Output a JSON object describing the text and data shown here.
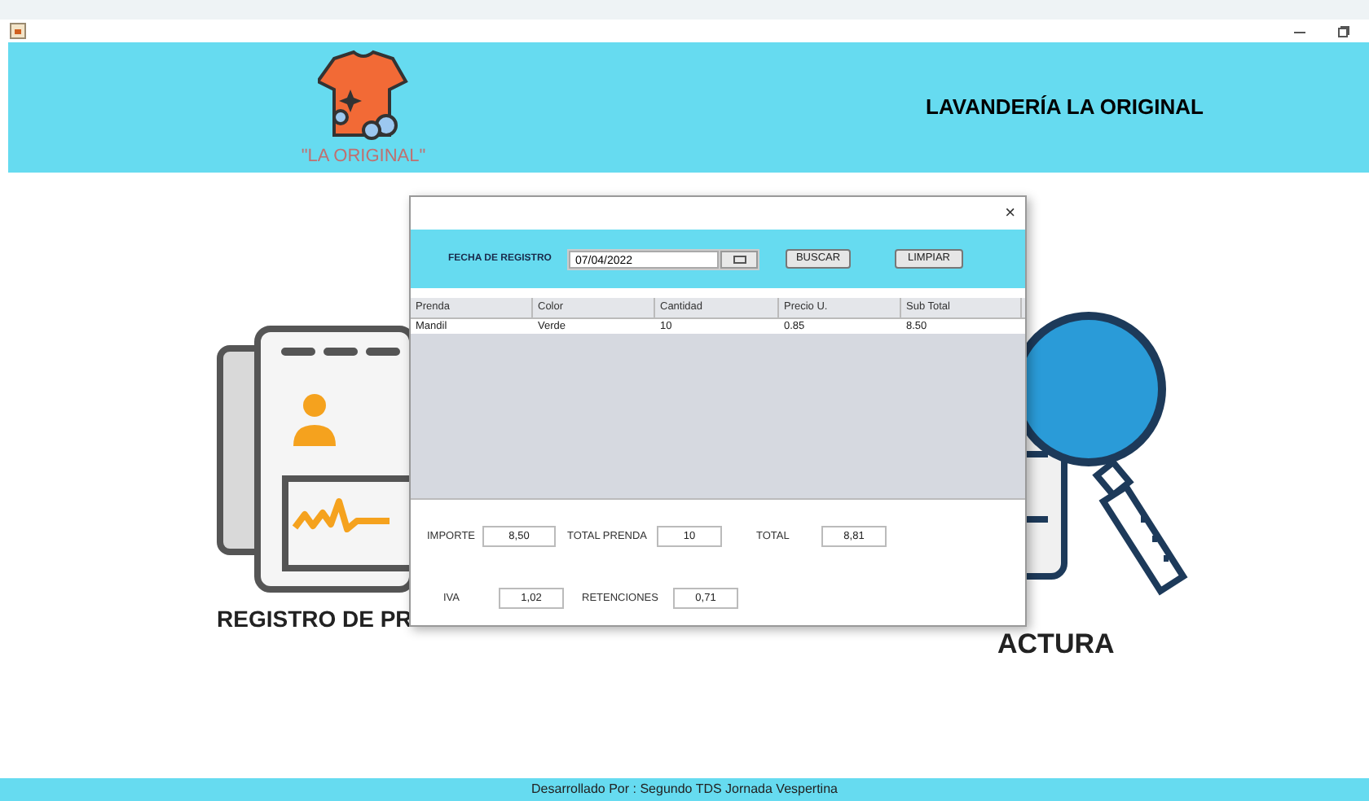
{
  "header": {
    "logo_caption": "\"LA ORIGINAL\"",
    "title": "LAVANDERÍA LA ORIGINAL"
  },
  "main": {
    "left_label": "REGISTRO DE PR",
    "right_label": "ACTURA"
  },
  "dialog": {
    "close": "×",
    "date_label": "FECHA DE REGISTRO",
    "date_value": "07/04/2022",
    "buttons": [
      "BUSCAR",
      "LIMPIAR"
    ],
    "table": {
      "columns": [
        "Prenda",
        "Color",
        "Cantidad",
        "Precio U.",
        "Sub Total"
      ],
      "rows": [
        [
          "Mandil",
          "Verde",
          "10",
          "0.85",
          "8.50"
        ]
      ]
    },
    "summary_rows": [
      [
        {
          "label": "IMPORTE",
          "value": "8,50"
        },
        {
          "label": "TOTAL PRENDA",
          "value": "10"
        },
        {
          "label": "TOTAL",
          "value": "8,81"
        }
      ],
      [
        {
          "label": "IVA",
          "value": "1,02"
        },
        {
          "label": "RETENCIONES",
          "value": "0,71"
        }
      ]
    ]
  },
  "footer": "Desarrollado Por : Segundo TDS Jornada Vespertina"
}
